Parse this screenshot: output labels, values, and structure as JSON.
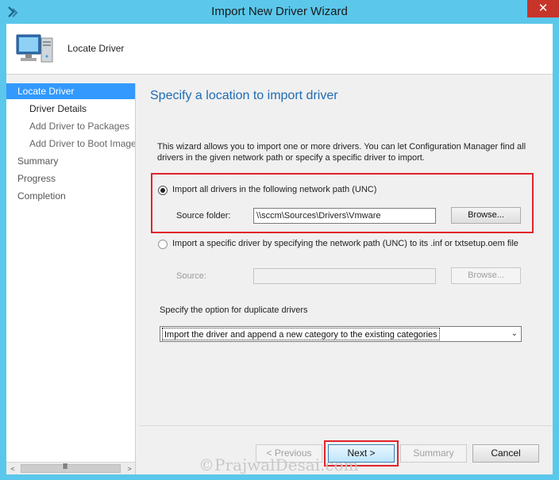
{
  "window": {
    "title": "Import New Driver Wizard",
    "close_glyph": "✕"
  },
  "header": {
    "title": "Locate Driver",
    "icon": "computer-icon"
  },
  "nav": {
    "items": [
      {
        "label": "Locate Driver",
        "state": "active"
      },
      {
        "label": "Driver Details",
        "state": "sub-current"
      },
      {
        "label": "Add Driver to Packages",
        "state": "sub"
      },
      {
        "label": "Add Driver to Boot Images",
        "state": "sub"
      },
      {
        "label": "Summary",
        "state": "normal"
      },
      {
        "label": "Progress",
        "state": "normal"
      },
      {
        "label": "Completion",
        "state": "normal"
      }
    ],
    "scroll_left": "<",
    "scroll_right": ">",
    "scroll_grip": "III"
  },
  "page": {
    "title": "Specify a location to import driver",
    "description": "This wizard allows you to import one or more drivers. You can let Configuration Manager find all drivers in the given network path or specify a specific driver to import.",
    "option_unc": {
      "label": "Import all drivers in the following network path (UNC)",
      "checked": true,
      "source_label": "Source folder:",
      "source_value": "\\\\sccm\\Sources\\Drivers\\Vmware",
      "browse_label": "Browse..."
    },
    "option_specific": {
      "label": "Import a specific driver by specifying the network path (UNC) to its .inf or txtsetup.oem file",
      "checked": false,
      "source_label": "Source:",
      "source_value": "",
      "browse_label": "Browse..."
    },
    "duplicate": {
      "label": "Specify the option for duplicate drivers",
      "selected": "Import the driver and append a new category to the existing categories"
    }
  },
  "footer": {
    "previous": "< Previous",
    "next": "Next >",
    "summary": "Summary",
    "cancel": "Cancel"
  },
  "watermark": "©PrajwalDesai.com",
  "colors": {
    "titlebar": "#5bc7ea",
    "close": "#c7342a",
    "nav_active": "#3399ff",
    "page_title": "#1f6bb3",
    "highlight": "#e0242c"
  }
}
